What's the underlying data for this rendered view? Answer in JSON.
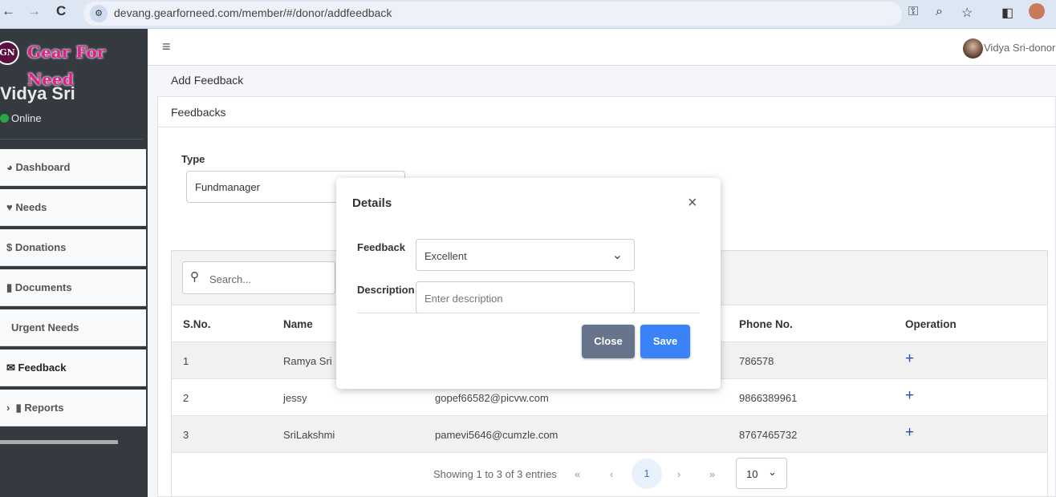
{
  "browser": {
    "url": "devang.gearforneed.com/member/#/donor/addfeedback",
    "back": "←",
    "forward": "→",
    "reload": "C",
    "icons": [
      "key-icon",
      "zoom-icon",
      "star-icon",
      "sidepanel-icon",
      "profile-icon"
    ]
  },
  "sidebar": {
    "logo": "Gear For Need",
    "user_name": "Vidya Sri",
    "status": "Online",
    "status_color": "#28a745",
    "items": [
      {
        "label": "Dashboard",
        "icon": "◕"
      },
      {
        "label": "Needs",
        "icon": "♥"
      },
      {
        "label": "Donations",
        "icon": "$"
      },
      {
        "label": "Documents",
        "icon": "▮"
      },
      {
        "label": "Urgent Needs",
        "icon": ""
      },
      {
        "label": "Feedback",
        "icon": "✉"
      },
      {
        "label": "Reports",
        "icon": "▮",
        "chevron": "›"
      }
    ]
  },
  "topbar": {
    "menu_icon": "≡",
    "user": "Vidya Sri-donor"
  },
  "breadcrumb": "Add Feedback",
  "card": {
    "title": "Feedbacks",
    "type_label": "Type",
    "type_value": "Fundmanager"
  },
  "table": {
    "search_placeholder": "Search...",
    "headers": [
      "S.No.",
      "Name",
      "Phone No.",
      "Operation"
    ],
    "rows": [
      {
        "sno": "1",
        "name": "Ramya Sri",
        "email": "",
        "phone": "786578",
        "op": "+"
      },
      {
        "sno": "2",
        "name": "jessy",
        "email": "gopef66582@picvw.com",
        "phone": "9866389961",
        "op": "+"
      },
      {
        "sno": "3",
        "name": "SriLakshmi",
        "email": "pamevi5646@cumzle.com",
        "phone": "8767465732",
        "op": "+"
      }
    ],
    "footer": {
      "info": "Showing 1 to 3 of 3 entries",
      "first": "«",
      "prev": "‹",
      "page": "1",
      "next": "›",
      "last": "»",
      "page_size": "10"
    }
  },
  "modal": {
    "title": "Details",
    "close_x": "×",
    "feedback_label": "Feedback",
    "feedback_value": "Excellent",
    "description_label": "Description",
    "description_placeholder": "Enter description",
    "close_button": "Close",
    "save_button": "Save",
    "close_color": "#66758c",
    "save_color": "#3b82f6"
  }
}
